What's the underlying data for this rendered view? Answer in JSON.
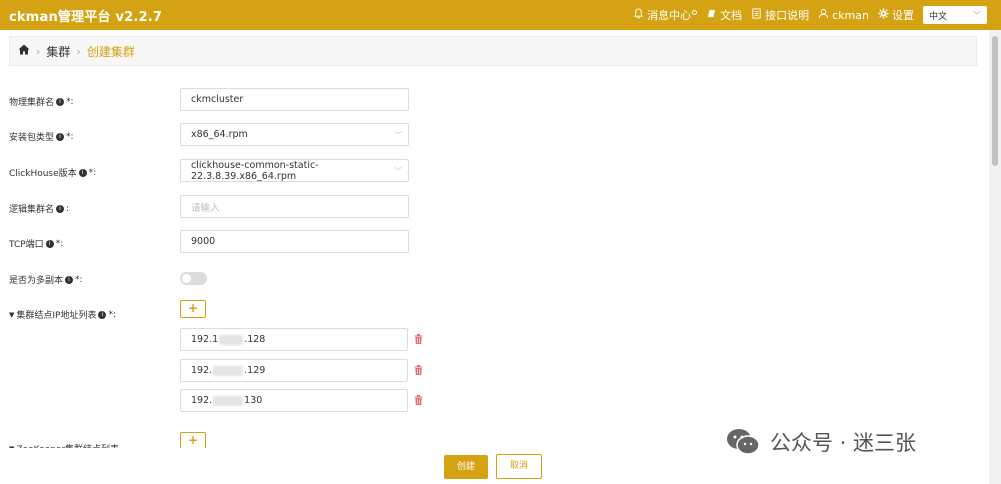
{
  "app": {
    "title": "ckman管理平台 v2.2.7"
  },
  "topnav": {
    "messages": "消息中心",
    "docs": "文档",
    "api": "接口说明",
    "user": "ckman",
    "settings": "设置",
    "language": "中文"
  },
  "breadcrumb": {
    "level1": "集群",
    "level2": "创建集群"
  },
  "form": {
    "cluster_name": {
      "label": "物理集群名",
      "required": " *:",
      "value": "ckmcluster"
    },
    "package_type": {
      "label": "安装包类型",
      "required": " *:",
      "value": "x86_64.rpm"
    },
    "ck_version": {
      "label": "ClickHouse版本",
      "required": " *:",
      "value": "clickhouse-common-static-22.3.8.39.x86_64.rpm"
    },
    "logic_name": {
      "label": "逻辑集群名",
      "required": ":",
      "placeholder": "请输入"
    },
    "tcp_port": {
      "label": "TCP端口",
      "required": " *:",
      "value": "9000"
    },
    "multi_replica": {
      "label": "是否为多副本",
      "required": " *:",
      "enabled": false
    },
    "node_list": {
      "label": "集群结点IP地址列表",
      "required": " *:",
      "add_label": "+",
      "ips": [
        {
          "prefix": "192.1",
          "suffix": ".128"
        },
        {
          "prefix": "192.",
          "suffix": ".129"
        },
        {
          "prefix": "192.",
          "suffix": "130"
        }
      ]
    },
    "zk_list": {
      "label": "ZooKeeper集群结点列表",
      "add_label": "+"
    }
  },
  "buttons": {
    "create": "创建",
    "cancel": "取消"
  },
  "watermark": {
    "text": "公众号 · 迷三张"
  },
  "colors": {
    "accent": "#d4a212",
    "danger": "#e07070"
  }
}
